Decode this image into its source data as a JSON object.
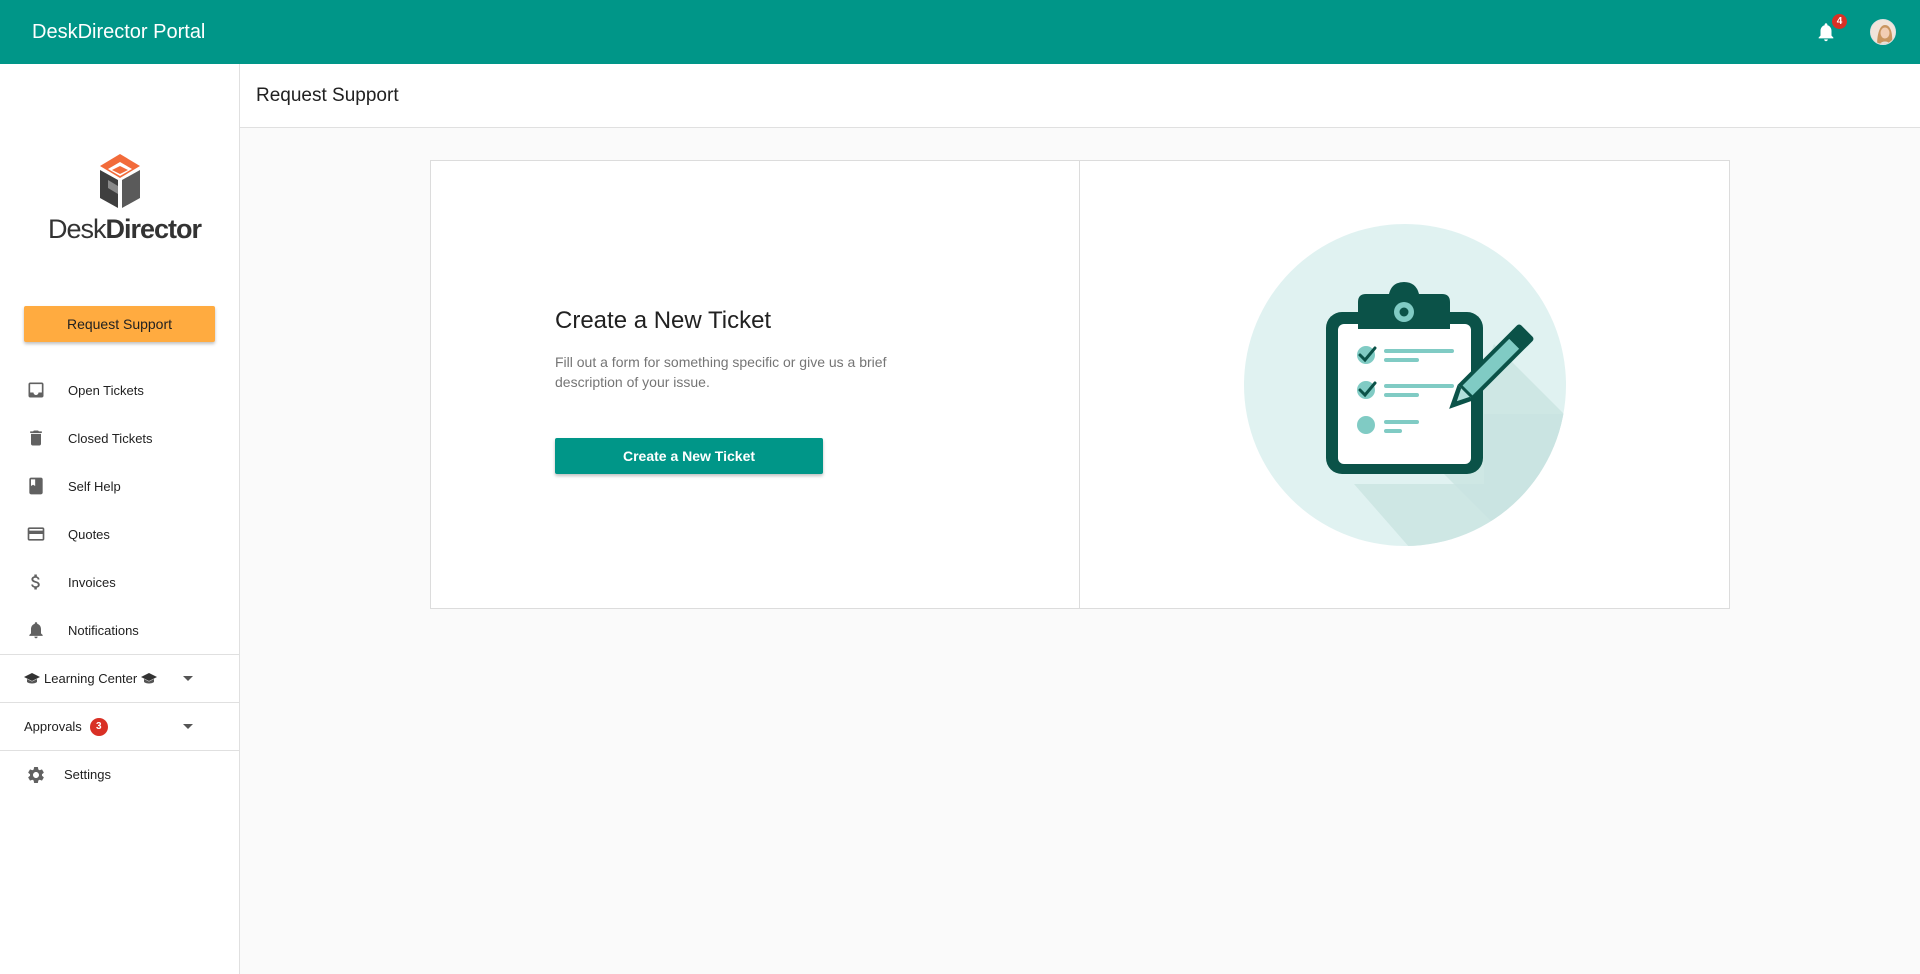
{
  "topbar": {
    "title": "DeskDirector Portal",
    "notifications_count": "4"
  },
  "sidebar": {
    "logo": {
      "brand_light": "Desk",
      "brand_bold": "Director"
    },
    "request_button": "Request Support",
    "items": [
      {
        "label": "Open Tickets",
        "icon": "inbox-icon"
      },
      {
        "label": "Closed Tickets",
        "icon": "trash-icon"
      },
      {
        "label": "Self Help",
        "icon": "book-icon"
      },
      {
        "label": "Quotes",
        "icon": "credit-card-icon"
      },
      {
        "label": "Invoices",
        "icon": "dollar-icon"
      },
      {
        "label": "Notifications",
        "icon": "bell-icon"
      }
    ],
    "sections": {
      "learning": {
        "label": "Learning Center"
      },
      "approvals": {
        "label": "Approvals",
        "count": "3"
      },
      "settings": {
        "label": "Settings"
      }
    }
  },
  "page": {
    "title": "Request Support"
  },
  "card": {
    "heading": "Create a New Ticket",
    "description": "Fill out a form for something specific or give us a brief description of your issue.",
    "button": "Create a New Ticket"
  },
  "colors": {
    "primary": "#009688",
    "accent": "#ffab40",
    "badge": "#d93025",
    "dark_teal": "#0b5248",
    "light_teal": "#80cbc4"
  }
}
